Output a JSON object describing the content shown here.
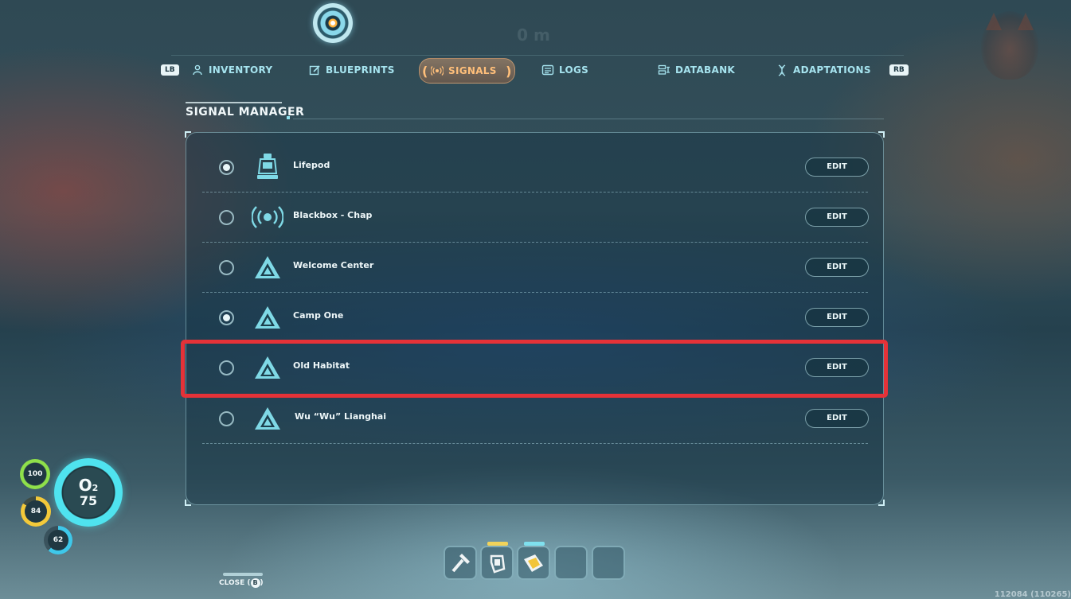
{
  "hud_top": {
    "depth": "0 m"
  },
  "tabs": {
    "left_bumper": "LB",
    "right_bumper": "RB",
    "items": [
      {
        "label": "INVENTORY",
        "icon": "diver-icon"
      },
      {
        "label": "BLUEPRINTS",
        "icon": "blueprint-icon"
      },
      {
        "label": "SIGNALS",
        "icon": "signal-icon",
        "active": true
      },
      {
        "label": "LOGS",
        "icon": "log-icon"
      },
      {
        "label": "DATABANK",
        "icon": "databank-icon"
      },
      {
        "label": "ADAPTATIONS",
        "icon": "dna-icon"
      }
    ]
  },
  "signal_manager": {
    "title": "SIGNAL MANAGER",
    "edit_label": "EDIT",
    "signals": [
      {
        "name": "Lifepod",
        "icon": "lifepod-icon",
        "selected": true
      },
      {
        "name": "Blackbox - Chap",
        "icon": "broadcast-icon",
        "selected": false
      },
      {
        "name": "Welcome Center",
        "icon": "beacon-icon",
        "selected": false
      },
      {
        "name": "Camp One",
        "icon": "beacon-icon",
        "selected": true
      },
      {
        "name": "Old Habitat",
        "icon": "beacon-icon",
        "selected": false,
        "highlighted": true
      },
      {
        "name": "Wu “Wu” Lianghai",
        "icon": "beacon-icon",
        "selected": false
      }
    ]
  },
  "hud": {
    "health": "100",
    "food": "84",
    "water": "62",
    "oxygen_label": "O",
    "oxygen_sub": "2",
    "oxygen_value": "75",
    "colors": {
      "health": "#8fe04a",
      "food": "#f3c93a",
      "water": "#3ec8ea",
      "oxygen": "#4fe3ef"
    }
  },
  "hotbar": {
    "slots": [
      {
        "icon": "hammer-tool-icon"
      },
      {
        "icon": "scanner-tool-icon"
      },
      {
        "icon": "repair-tool-icon"
      },
      {
        "icon": ""
      },
      {
        "icon": ""
      }
    ]
  },
  "footer": {
    "close_prefix": "CLOSE (",
    "close_button": "B",
    "close_suffix": ")",
    "coords": "112084 (110265)"
  },
  "colors": {
    "accent": "#a6e4ef",
    "active_tab": "#ffbf7a",
    "highlight": "#e53238"
  }
}
